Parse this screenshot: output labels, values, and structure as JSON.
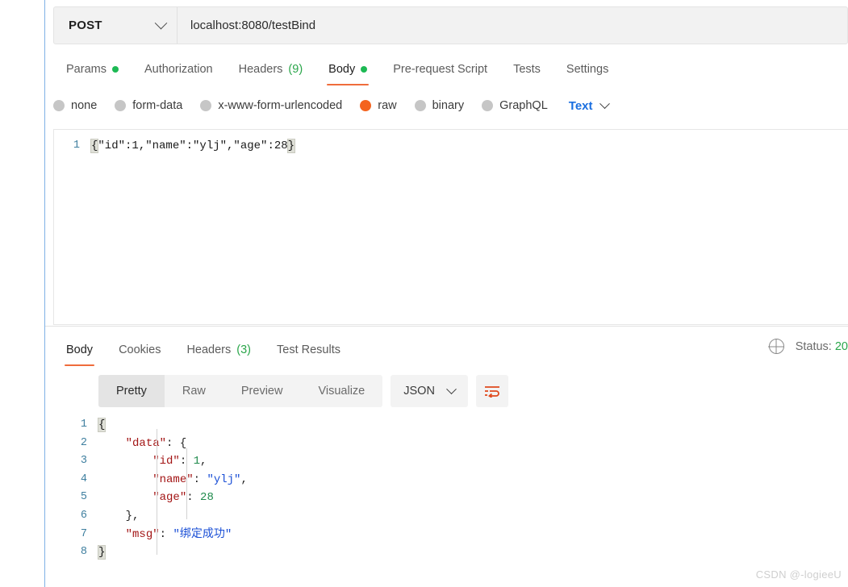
{
  "request": {
    "method": "POST",
    "method_icon": "chevron-down-icon",
    "url": "localhost:8080/testBind",
    "tabs": [
      {
        "label": "Params",
        "dot": true,
        "count": "",
        "active": false
      },
      {
        "label": "Authorization",
        "dot": false,
        "count": "",
        "active": false
      },
      {
        "label": "Headers",
        "dot": false,
        "count": "(9)",
        "active": false
      },
      {
        "label": "Body",
        "dot": true,
        "count": "",
        "active": true
      },
      {
        "label": "Pre-request Script",
        "dot": false,
        "count": "",
        "active": false
      },
      {
        "label": "Tests",
        "dot": false,
        "count": "",
        "active": false
      },
      {
        "label": "Settings",
        "dot": false,
        "count": "",
        "active": false
      }
    ],
    "body_types": [
      {
        "label": "none",
        "selected": false
      },
      {
        "label": "form-data",
        "selected": false
      },
      {
        "label": "x-www-form-urlencoded",
        "selected": false
      },
      {
        "label": "raw",
        "selected": true
      },
      {
        "label": "binary",
        "selected": false
      },
      {
        "label": "GraphQL",
        "selected": false
      }
    ],
    "raw_format": "Text",
    "editor": {
      "line_number": "1",
      "open_brace": "{",
      "content": "\"id\":1,\"name\":\"ylj\",\"age\":28",
      "close_brace": "}"
    }
  },
  "response": {
    "tabs": [
      {
        "label": "Body",
        "count": "",
        "active": true
      },
      {
        "label": "Cookies",
        "count": "",
        "active": false
      },
      {
        "label": "Headers",
        "count": "(3)",
        "active": false
      },
      {
        "label": "Test Results",
        "count": "",
        "active": false
      }
    ],
    "status_label": "Status:",
    "status_code": "20",
    "globe_icon": "globe-icon",
    "view_modes": [
      {
        "label": "Pretty",
        "active": true
      },
      {
        "label": "Raw",
        "active": false
      },
      {
        "label": "Preview",
        "active": false
      },
      {
        "label": "Visualize",
        "active": false
      }
    ],
    "format": "JSON",
    "wrap_icon": "word-wrap-icon",
    "body_lines": [
      {
        "num": "1",
        "indent": 0,
        "tokens": [
          {
            "t": "{",
            "c": "brace-hl"
          }
        ]
      },
      {
        "num": "2",
        "indent": 1,
        "tokens": [
          {
            "t": "\"data\"",
            "c": "k"
          },
          {
            "t": ": ",
            "c": "p"
          },
          {
            "t": "{",
            "c": "p"
          }
        ]
      },
      {
        "num": "3",
        "indent": 2,
        "tokens": [
          {
            "t": "\"id\"",
            "c": "k"
          },
          {
            "t": ": ",
            "c": "p"
          },
          {
            "t": "1",
            "c": "n"
          },
          {
            "t": ",",
            "c": "p"
          }
        ]
      },
      {
        "num": "4",
        "indent": 2,
        "tokens": [
          {
            "t": "\"name\"",
            "c": "k"
          },
          {
            "t": ": ",
            "c": "p"
          },
          {
            "t": "\"ylj\"",
            "c": "s"
          },
          {
            "t": ",",
            "c": "p"
          }
        ]
      },
      {
        "num": "5",
        "indent": 2,
        "tokens": [
          {
            "t": "\"age\"",
            "c": "k"
          },
          {
            "t": ": ",
            "c": "p"
          },
          {
            "t": "28",
            "c": "n"
          }
        ]
      },
      {
        "num": "6",
        "indent": 1,
        "tokens": [
          {
            "t": "}",
            "c": "p"
          },
          {
            "t": ",",
            "c": "p"
          }
        ]
      },
      {
        "num": "7",
        "indent": 1,
        "tokens": [
          {
            "t": "\"msg\"",
            "c": "k"
          },
          {
            "t": ": ",
            "c": "p"
          },
          {
            "t": "\"绑定成功\"",
            "c": "s"
          }
        ]
      },
      {
        "num": "8",
        "indent": 0,
        "tokens": [
          {
            "t": "}",
            "c": "brace-hl"
          }
        ]
      }
    ]
  },
  "watermark": "CSDN @-logieeU",
  "colors": {
    "accent_orange": "#ef6c3b",
    "radio_orange": "#f4631e",
    "green_dot": "#1db954",
    "link_blue": "#1a6fe0",
    "json_key": "#a31515",
    "json_string": "#1a4fd6",
    "json_number": "#1f8a4c"
  }
}
